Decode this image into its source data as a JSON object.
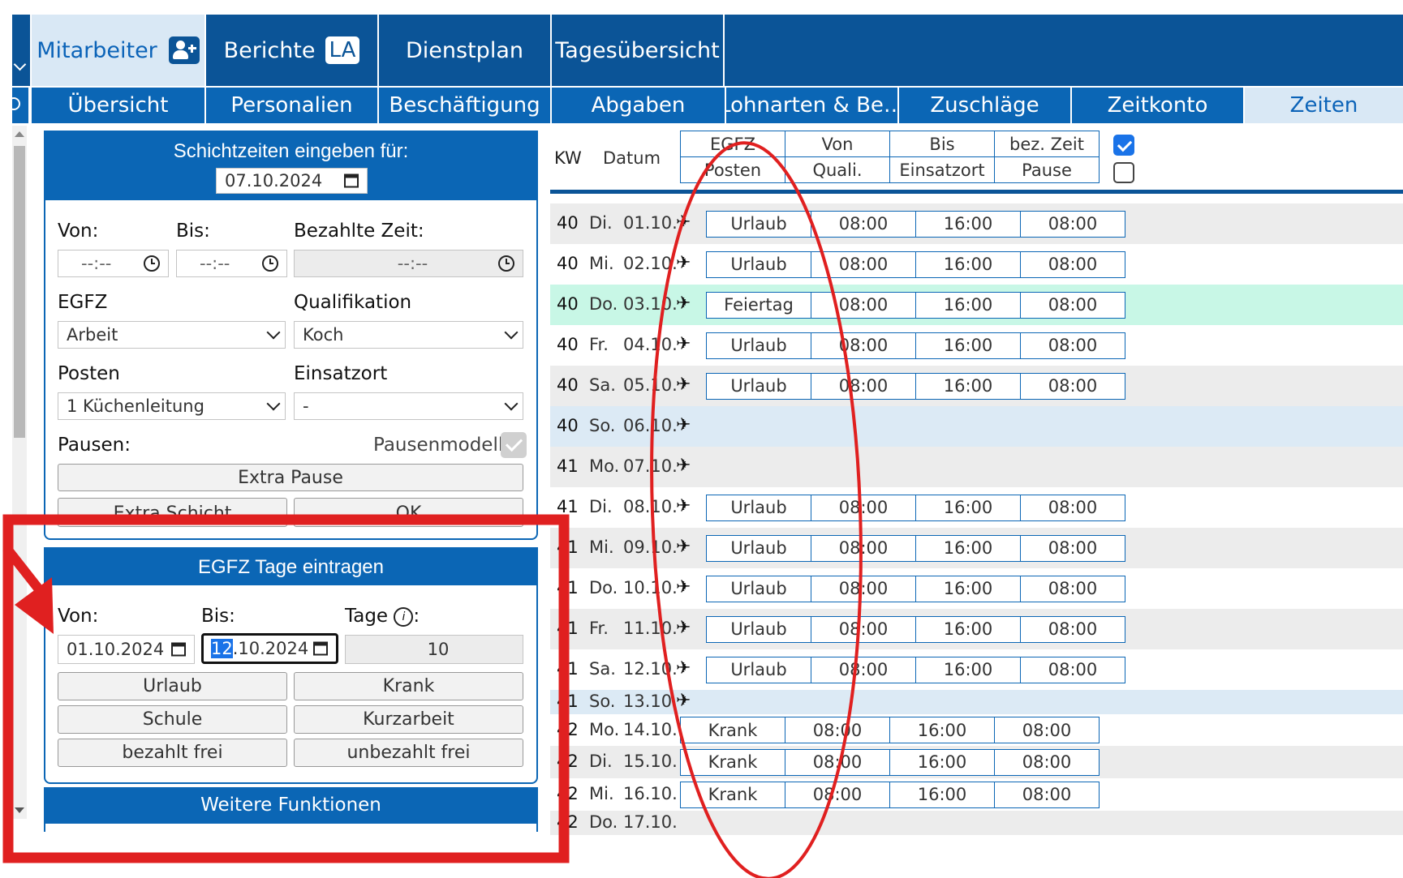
{
  "nav": {
    "main_tabs": [
      {
        "label": "Mitarbeiter"
      },
      {
        "label": "Berichte",
        "badge": "LA"
      },
      {
        "label": "Dienstplan"
      },
      {
        "label": "Tagesübersicht"
      }
    ],
    "sub_tabs": [
      "Übersicht",
      "Personalien",
      "Beschäftigung",
      "Abgaben",
      "Lohnarten & Be…",
      "Zuschläge",
      "Zeitkonto",
      "Zeiten"
    ]
  },
  "shift_form": {
    "title": "Schichtzeiten eingeben für:",
    "date": "07.10.2024",
    "von_label": "Von:",
    "bis_label": "Bis:",
    "paid_label": "Bezahlte Zeit:",
    "time_placeholder": "--:--",
    "egfz_label": "EGFZ",
    "egfz_value": "Arbeit",
    "quali_label": "Qualifikation",
    "quali_value": "Koch",
    "posten_label": "Posten",
    "posten_value": "1 Küchenleitung",
    "einsatz_label": "Einsatzort",
    "einsatz_value": "-",
    "pausen_label": "Pausen:",
    "pausenmodell_label": "Pausenmodell",
    "extra_pause": "Extra Pause",
    "extra_schicht": "Extra Schicht",
    "ok": "OK"
  },
  "egfz_days": {
    "title": "EGFZ Tage eintragen",
    "von_label": "Von:",
    "bis_label": "Bis:",
    "tage_label": "Tage",
    "von_value": "01.10.2024",
    "bis_day": "12",
    "bis_rest": ".10.2024",
    "tage_value": "10",
    "buttons": [
      "Urlaub",
      "Krank",
      "Schule",
      "Kurzarbeit",
      "bezahlt frei",
      "unbezahlt frei"
    ]
  },
  "more_functions": "Weitere Funktionen",
  "table": {
    "kw_header": "KW",
    "datum_header": "Datum",
    "headers_top": [
      "EGFZ",
      "Von",
      "Bis",
      "bez. Zeit"
    ],
    "headers_bottom": [
      "Posten",
      "Quali.",
      "Einsatzort",
      "Pause"
    ],
    "rows": [
      {
        "kw": "40",
        "day": "Di.",
        "date": "01.10.",
        "egfz": "Urlaub",
        "von": "08:00",
        "bis": "16:00",
        "bez": "08:00"
      },
      {
        "kw": "40",
        "day": "Mi.",
        "date": "02.10.",
        "egfz": "Urlaub",
        "von": "08:00",
        "bis": "16:00",
        "bez": "08:00"
      },
      {
        "kw": "40",
        "day": "Do.",
        "date": "03.10.",
        "egfz": "Feiertag",
        "von": "08:00",
        "bis": "16:00",
        "bez": "08:00"
      },
      {
        "kw": "40",
        "day": "Fr.",
        "date": "04.10.",
        "egfz": "Urlaub",
        "von": "08:00",
        "bis": "16:00",
        "bez": "08:00"
      },
      {
        "kw": "40",
        "day": "Sa.",
        "date": "05.10.",
        "egfz": "Urlaub",
        "von": "08:00",
        "bis": "16:00",
        "bez": "08:00"
      },
      {
        "kw": "40",
        "day": "So.",
        "date": "06.10."
      },
      {
        "kw": "41",
        "day": "Mo.",
        "date": "07.10."
      },
      {
        "kw": "41",
        "day": "Di.",
        "date": "08.10.",
        "egfz": "Urlaub",
        "von": "08:00",
        "bis": "16:00",
        "bez": "08:00"
      },
      {
        "kw": "41",
        "day": "Mi.",
        "date": "09.10.",
        "egfz": "Urlaub",
        "von": "08:00",
        "bis": "16:00",
        "bez": "08:00"
      },
      {
        "kw": "41",
        "day": "Do.",
        "date": "10.10.",
        "egfz": "Urlaub",
        "von": "08:00",
        "bis": "16:00",
        "bez": "08:00"
      },
      {
        "kw": "41",
        "day": "Fr.",
        "date": "11.10.",
        "egfz": "Urlaub",
        "von": "08:00",
        "bis": "16:00",
        "bez": "08:00"
      },
      {
        "kw": "41",
        "day": "Sa.",
        "date": "12.10.",
        "egfz": "Urlaub",
        "von": "08:00",
        "bis": "16:00",
        "bez": "08:00"
      },
      {
        "kw": "41",
        "day": "So.",
        "date": "13.10."
      },
      {
        "kw": "42",
        "day": "Mo.",
        "date": "14.10.",
        "egfz": "Krank",
        "von": "08:00",
        "bis": "16:00",
        "bez": "08:00"
      },
      {
        "kw": "42",
        "day": "Di.",
        "date": "15.10.",
        "egfz": "Krank",
        "von": "08:00",
        "bis": "16:00",
        "bez": "08:00"
      },
      {
        "kw": "42",
        "day": "Mi.",
        "date": "16.10.",
        "egfz": "Krank",
        "von": "08:00",
        "bis": "16:00",
        "bez": "08:00"
      },
      {
        "kw": "42",
        "day": "Do.",
        "date": "17.10."
      }
    ]
  },
  "colors": {
    "nav": "#0b5497",
    "tab": "#0b66b5",
    "active_tab": "#d9e8f5",
    "holiday_row": "#c8f7e6",
    "sunday_row": "#dceaf5",
    "alt_row": "#ececec",
    "annotation": "#e02020"
  }
}
